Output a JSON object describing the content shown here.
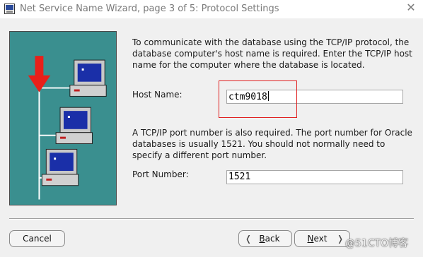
{
  "window": {
    "title": "Net Service Name Wizard, page 3 of 5: Protocol Settings",
    "close_glyph": "✕"
  },
  "instructions": {
    "host": "To communicate with the database using the TCP/IP protocol, the database computer's host name is required.  Enter the TCP/IP host name for the computer where the database is located.",
    "port": "A TCP/IP port number is also required.  The port number for Oracle databases is usually 1521.  You should not normally need to specify a different port number."
  },
  "host": {
    "label": "Host Name:",
    "value": "ctm9018"
  },
  "port": {
    "label": "Port Number:",
    "value": "1521"
  },
  "buttons": {
    "cancel": "Cancel",
    "back_mnemonic": "B",
    "back_rest": "ack",
    "next_mnemonic": "N",
    "next_rest": "ext"
  },
  "watermark": "@51CTO博客",
  "colors": {
    "illustration_bg": "#3a8f8f",
    "highlight": "#e02020",
    "arrow": "#e8201a"
  },
  "icons": [
    "app-wizard-icon",
    "close-icon",
    "network-computers-illustration",
    "left-chevron-icon",
    "right-chevron-icon"
  ]
}
